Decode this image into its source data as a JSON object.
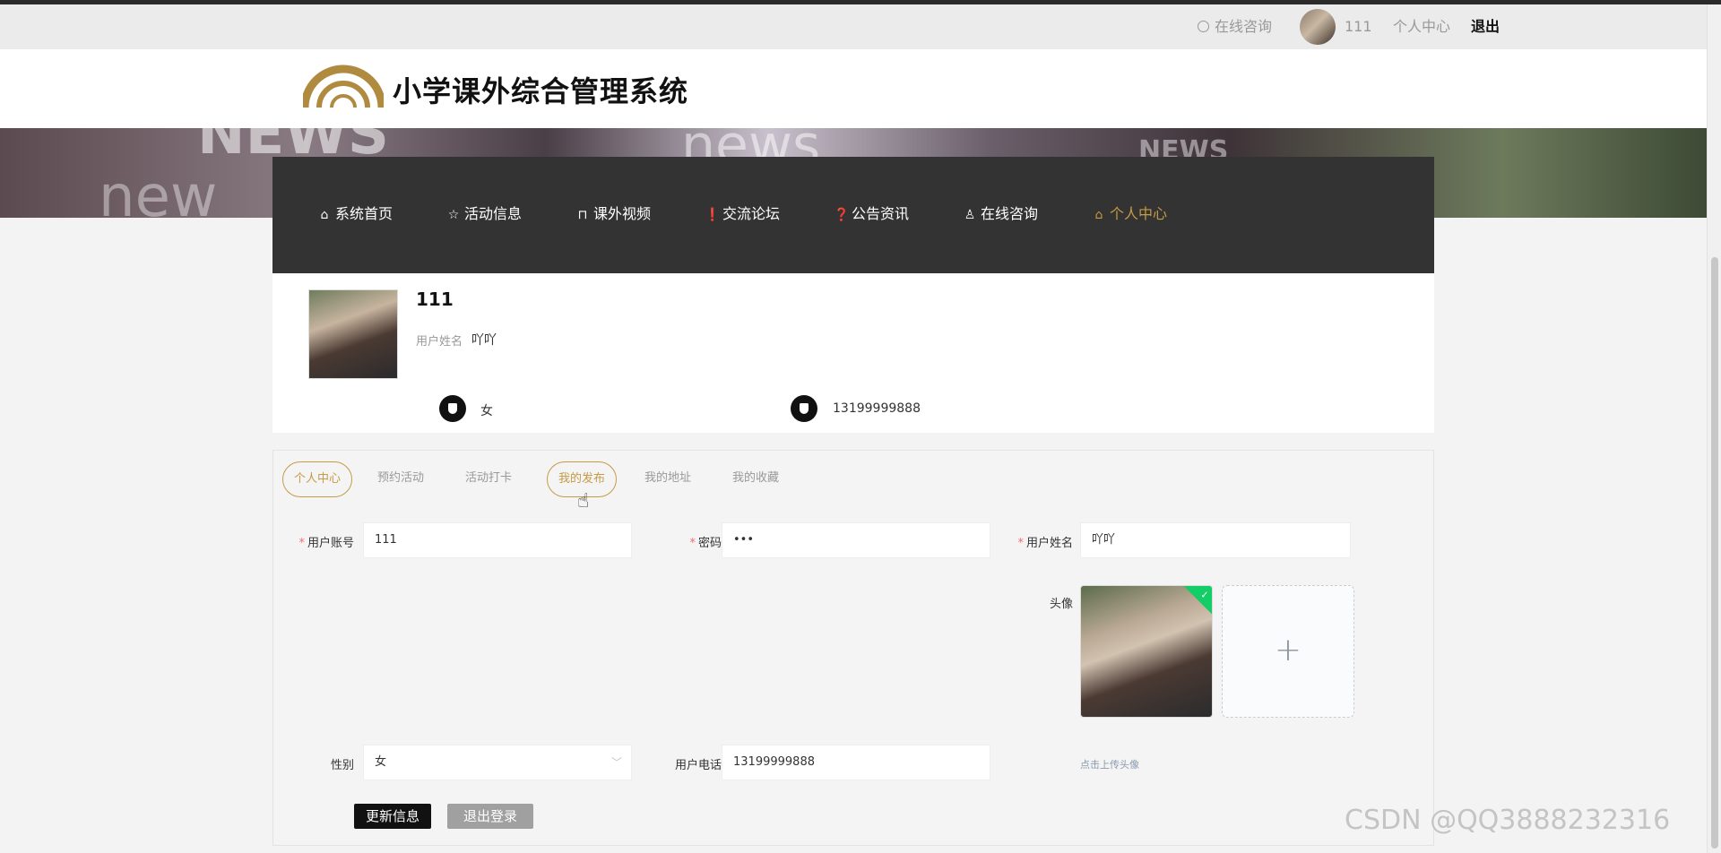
{
  "topbar": {
    "consult_label": "在线咨询",
    "username": "111",
    "center_label": "个人中心",
    "logout_label": "退出"
  },
  "header": {
    "site_title": "小学课外综合管理系统"
  },
  "banner": {
    "words": [
      "NEWS",
      "new",
      "news",
      "NEWS"
    ]
  },
  "nav": {
    "items": [
      {
        "label": "系统首页",
        "icon": "home-icon"
      },
      {
        "label": "活动信息",
        "icon": "star-icon"
      },
      {
        "label": "课外视频",
        "icon": "bag-icon"
      },
      {
        "label": "交流论坛",
        "icon": "exclamation-icon"
      },
      {
        "label": "公告资讯",
        "icon": "question-icon"
      },
      {
        "label": "在线咨询",
        "icon": "user-icon"
      },
      {
        "label": "个人中心",
        "icon": "home-icon"
      }
    ],
    "active_index": 6,
    "active_color": "#c59b45"
  },
  "profile": {
    "name": "111",
    "realname_label": "用户姓名",
    "realname": "吖吖",
    "gender": "女",
    "phone": "13199999888"
  },
  "tabs": [
    "个人中心",
    "预约活动",
    "活动打卡",
    "我的发布",
    "我的地址",
    "我的收藏"
  ],
  "form": {
    "account_label": "用户账号",
    "account_value": "111",
    "password_label": "密码",
    "password_value": "•••",
    "realname_label": "用户姓名",
    "realname_value": "吖吖",
    "avatar_label": "头像",
    "gender_label": "性别",
    "gender_value": "女",
    "phone_label": "用户电话",
    "phone_value": "13199999888",
    "upload_hint": "点击上传头像",
    "required_mark": "*"
  },
  "buttons": {
    "update": "更新信息",
    "logout": "退出登录"
  },
  "watermark": "CSDN @QQ3888232316",
  "colors": {
    "accent": "#c59b45",
    "nav_bg": "#333333",
    "required": "#f56c6c",
    "success": "#13ce66"
  }
}
